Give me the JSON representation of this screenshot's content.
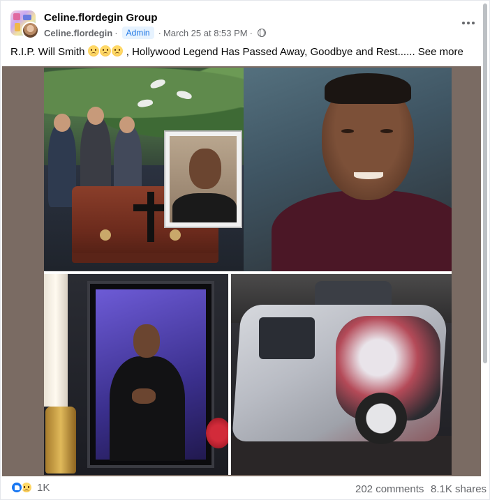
{
  "header": {
    "group_name": "Celine.flordegin Group",
    "author": "Celine.flordegin",
    "author_separator": "·",
    "badge": "Admin",
    "timestamp": "March 25 at 8:53 PM",
    "timestamp_separator": "·"
  },
  "icons": {
    "privacy": "globe-icon",
    "more": "more-options-icon",
    "reaction_1": "like-reaction-icon",
    "reaction_2": "sad-reaction-icon"
  },
  "caption": {
    "text_before": "R.I.P. Will Smith",
    "text_after": ", Hollywood Legend Has Passed Away, Goodbye and Rest......",
    "see_more": "See more"
  },
  "footer": {
    "reaction_count": "1K",
    "comments": "202 comments",
    "shares": "8.1K shares"
  },
  "colors": {
    "badge_bg": "#e7f3ff",
    "badge_text": "#1b74e4",
    "like_blue": "#1877f2",
    "secondary_text": "#65676b",
    "media_bg": "#7a6b63"
  }
}
